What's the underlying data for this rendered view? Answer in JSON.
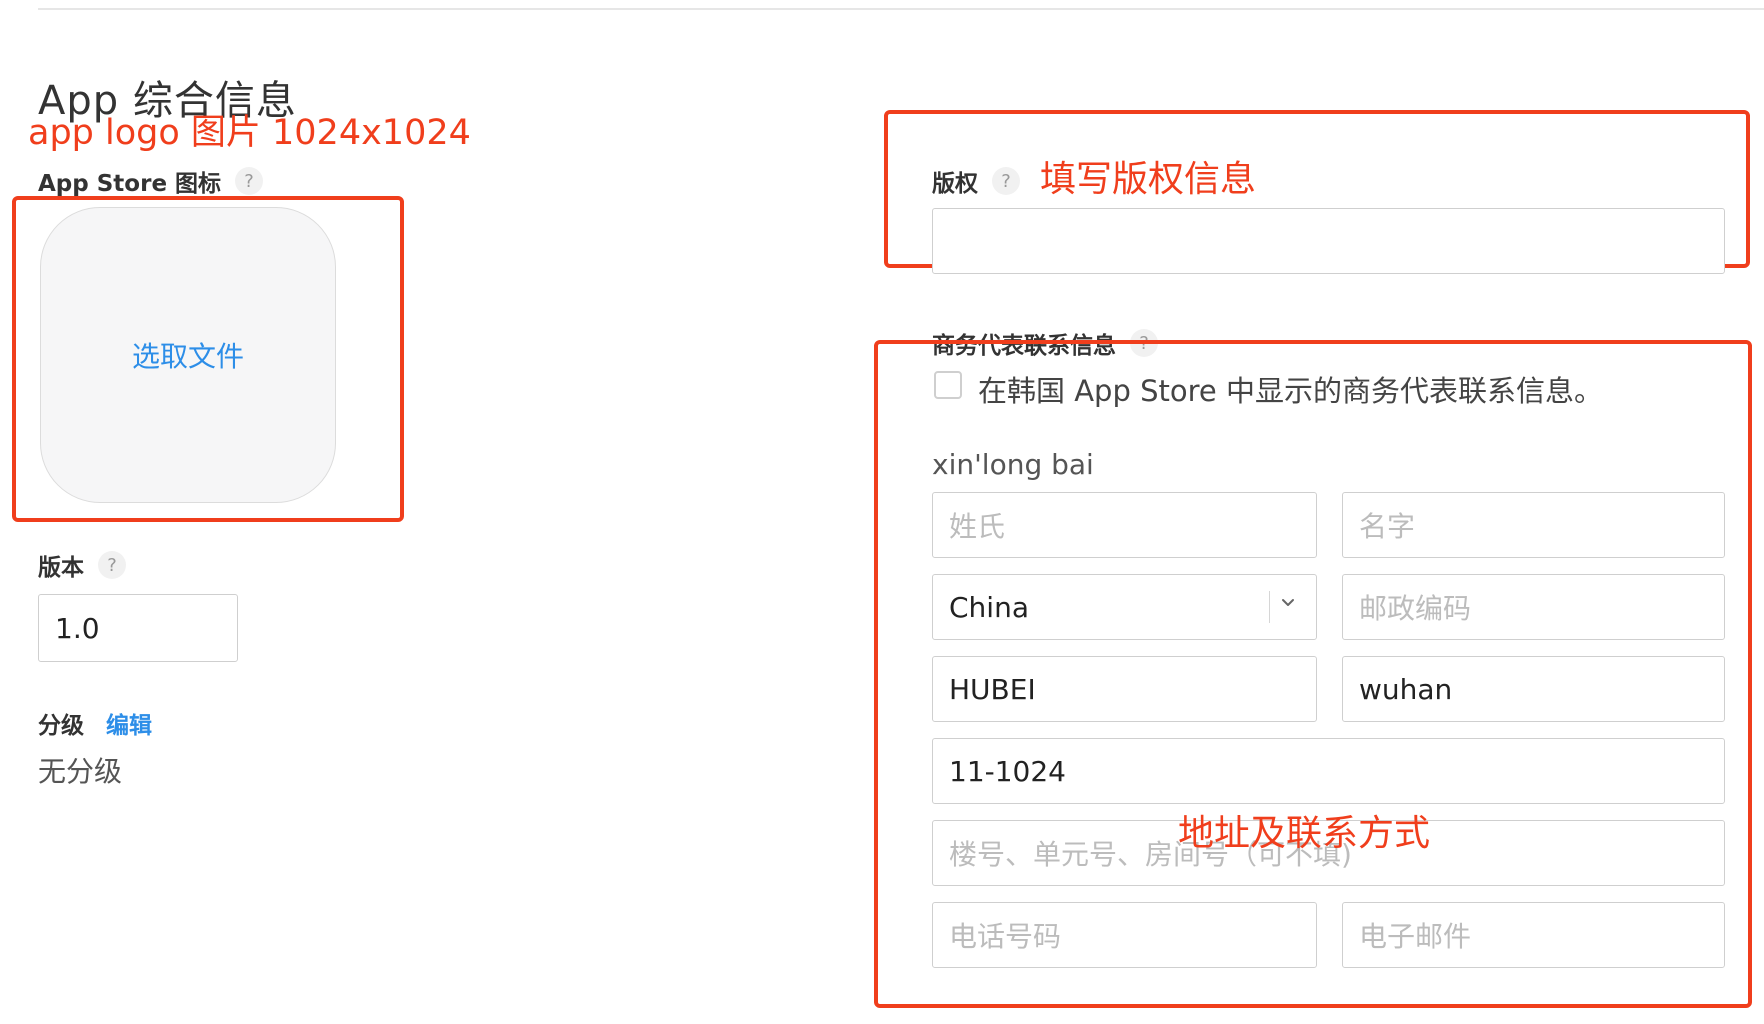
{
  "page": {
    "title": "App 综合信息"
  },
  "annotations": {
    "logo": "app logo 图片 1024x1024",
    "copyright": "填写版权信息",
    "address": "地址及联系方式"
  },
  "icon_section": {
    "label": "App Store 图标",
    "help": "?",
    "choose_file": "选取文件"
  },
  "version": {
    "label": "版本",
    "help": "?",
    "value": "1.0"
  },
  "rating": {
    "label": "分级",
    "edit": "编辑",
    "value": "无分级"
  },
  "copyright": {
    "label": "版权",
    "help": "?",
    "value": ""
  },
  "contact": {
    "label": "商务代表联系信息",
    "help": "?",
    "korea_checkbox_label": "在韩国 App Store 中显示的商务代表联系信息。",
    "korea_checked": false,
    "name_display": "xin'long bai",
    "last_name_placeholder": "姓氏",
    "first_name_placeholder": "名字",
    "country_value": "China",
    "postal_placeholder": "邮政编码",
    "state_value": "HUBEI",
    "city_value": "wuhan",
    "address_value": "11-1024",
    "address2_placeholder": "楼号、单元号、房间号（可不填)",
    "phone_placeholder": "电话号码",
    "email_placeholder": "电子邮件"
  },
  "colors": {
    "annotation_red": "#f03e1c",
    "link_blue": "#2d8ee8"
  }
}
